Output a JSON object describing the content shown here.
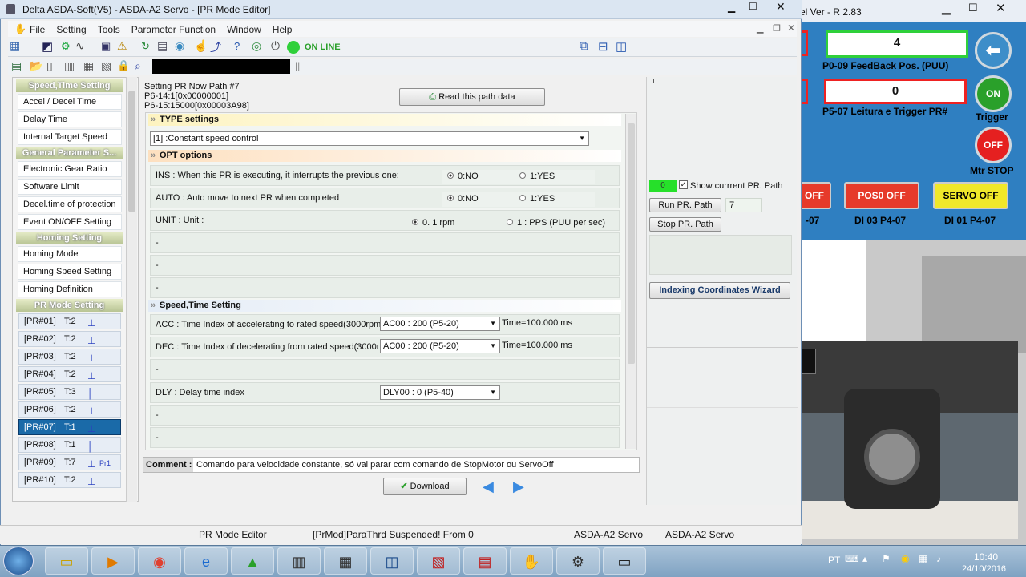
{
  "window": {
    "title": "Delta ASDA-Soft(V5) - ASDA-A2 Servo - [PR Mode Editor]"
  },
  "menu": [
    "File",
    "Setting",
    "Tools",
    "Parameter Function",
    "Window",
    "Help"
  ],
  "toolbar": {
    "online_label": "ON LINE"
  },
  "nav": {
    "sections": [
      {
        "header": "Speed,Time Setting",
        "items": [
          "Accel / Decel Time",
          "Delay Time",
          "Internal Target Speed"
        ]
      },
      {
        "header": "General Parameter S...",
        "items": [
          "Electronic Gear Ratio",
          "Software Limit",
          "Decel.time of protection",
          "Event ON/OFF Setting"
        ]
      },
      {
        "header": "Homing Setting",
        "items": [
          "Homing Mode",
          "Homing Speed Setting",
          "Homing Definition"
        ]
      }
    ],
    "pr_header": "PR Mode Setting",
    "pr_items": [
      {
        "name": "[PR#01]",
        "t": "T:2"
      },
      {
        "name": "[PR#02]",
        "t": "T:2"
      },
      {
        "name": "[PR#03]",
        "t": "T:2"
      },
      {
        "name": "[PR#04]",
        "t": "T:2"
      },
      {
        "name": "[PR#05]",
        "t": "T:3"
      },
      {
        "name": "[PR#06]",
        "t": "T:2"
      },
      {
        "name": "[PR#07]",
        "t": "T:1"
      },
      {
        "name": "[PR#08]",
        "t": "T:1"
      },
      {
        "name": "[PR#09]",
        "t": "T:7"
      },
      {
        "name": "[PR#10]",
        "t": "T:2"
      }
    ],
    "pr09_tag": "Pr1"
  },
  "editor": {
    "info_line1": "Setting PR Now Path #7",
    "info_line2": "P6-14:1[0x00000001]",
    "info_line3": "P6-15:15000[0x00003A98]",
    "read_button": "Read this path data",
    "type_section": "TYPE settings",
    "type_value": "[1] :Constant speed control",
    "opt_section": "OPT options",
    "ins_label": "INS : When this PR is executing, it interrupts the previous one:",
    "auto_label": "AUTO : Auto move to next PR when completed",
    "unit_label": "UNIT : Unit :",
    "opt_no": "0:NO",
    "opt_yes": "1:YES",
    "unit_opt1": "0. 1 rpm",
    "unit_opt2": "1 : PPS (PUU per sec)",
    "dash": "-",
    "speed_section": "Speed,Time Setting",
    "acc_label": "ACC : Time Index of accelerating to rated speed(3000rpm)",
    "acc_value": "AC00 : 200 (P5-20)",
    "acc_time": "Time=100.000 ms",
    "dec_label": "DEC : Time Index of decelerating from rated speed(3000rpm)",
    "dec_value": "AC00 : 200 (P5-20)",
    "dec_time": "Time=100.000 ms",
    "dly_label": "DLY : Delay time index",
    "dly_value": "DLY00 : 0 (P5-40)",
    "comment_label": "Comment :",
    "comment_value": "Comando para velocidade constante, só vai parar com comando de StopMotor ou ServoOff",
    "download_button": "Download"
  },
  "right": {
    "pr_count": "0",
    "show_current_label": "Show currrent PR. Path",
    "run_button": "Run PR. Path",
    "path_value": "7",
    "stop_button": "Stop PR. Path",
    "wizard_button": "Indexing Coordinates Wizard"
  },
  "status": {
    "s1": "PR Mode Editor",
    "s2": "[PrMod]ParaThrd Suspended! From 0",
    "s3": "ASDA-A2 Servo",
    "s4": "ASDA-A2 Servo"
  },
  "hmi": {
    "title_fragment": "el Ver - R 2.83",
    "feedback_value": "4",
    "feedback_label": "P0-09 FeedBack Pos. (PUU)",
    "trigger_value": "0",
    "trigger_label": "P5-07 Leitura e Trigger PR#",
    "on_label": "ON",
    "trigger_caption": "Trigger",
    "off_label": "OFF",
    "mtr_stop": "Mtr STOP",
    "btn_partial": "OFF",
    "btn_pos": "POS0 OFF",
    "btn_servo": "SERVO OFF",
    "lbl_partial": "-07",
    "lbl_di03": "DI 03 P4-07",
    "lbl_di01": "DI 01 P4-07",
    "hmi_accent": "#2f7fc1"
  },
  "taskbar": {
    "lang": "PT",
    "time": "10:40",
    "date": "24/10/2016"
  }
}
